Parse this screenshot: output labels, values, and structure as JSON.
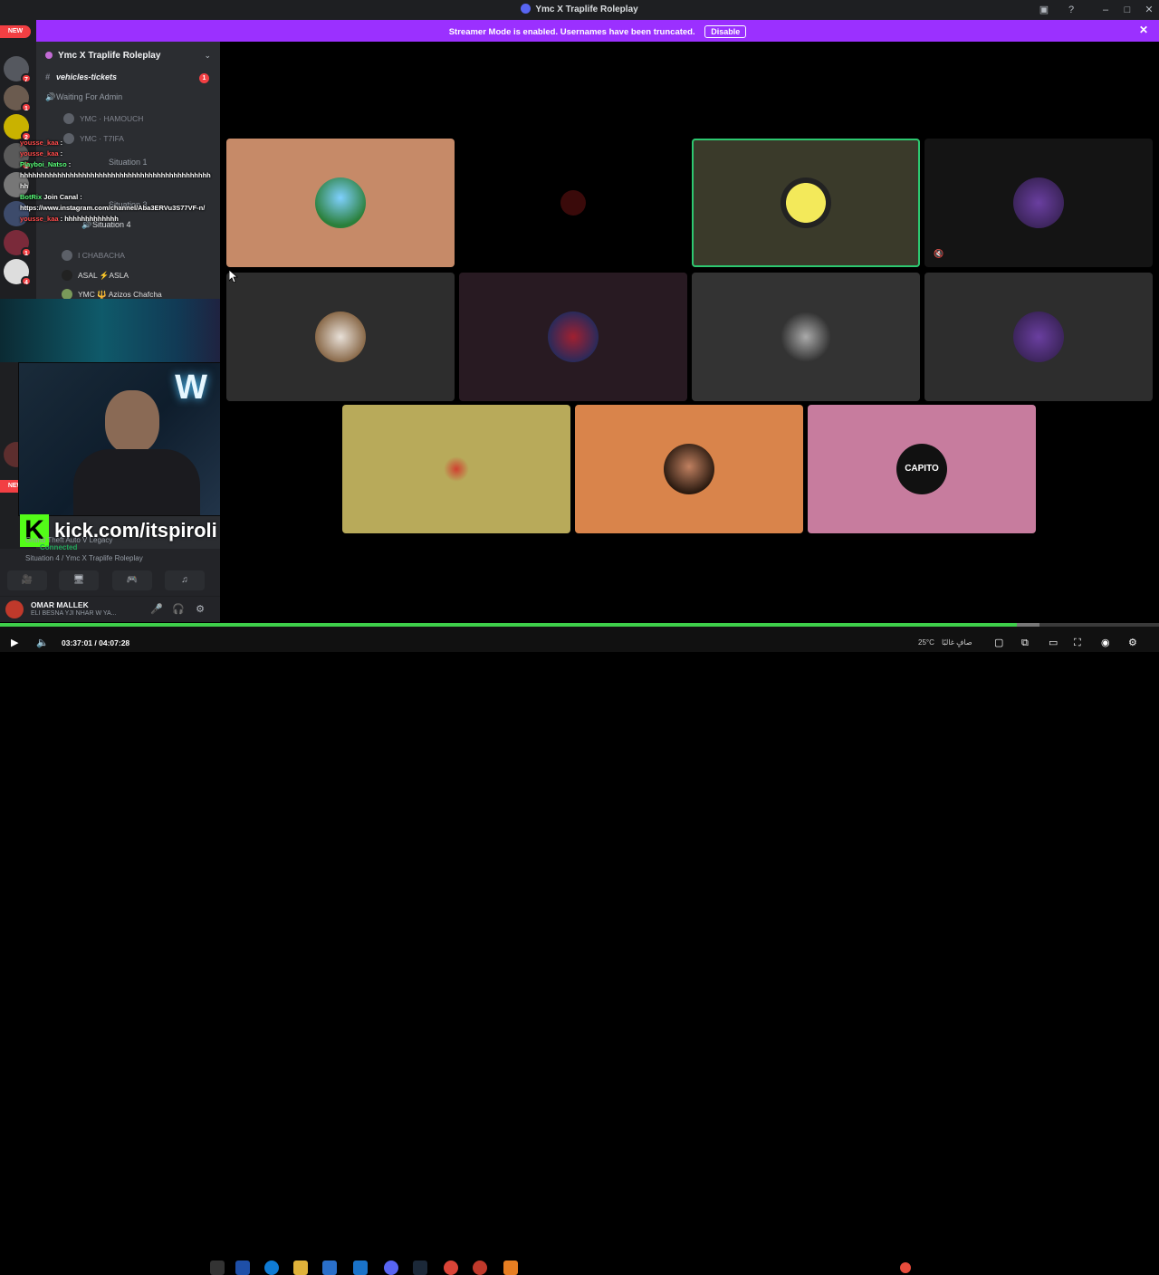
{
  "window": {
    "title": "Ymc X Traplife Roleplay"
  },
  "banner": {
    "message": "Streamer Mode is enabled. Usernames have been truncated.",
    "disable_label": "Disable"
  },
  "guilds": {
    "new_label": "NEW",
    "new_label_bottom": "NEW",
    "badges": [
      "7",
      "1",
      "2",
      "1",
      "1",
      "4",
      "6"
    ]
  },
  "server": {
    "name": "Ymc X Traplife Roleplay",
    "channels": [
      {
        "label": "vehicles-tickets",
        "count": "1"
      },
      {
        "label": "Waiting For Admin"
      }
    ],
    "voice_users": [
      "YMC · HAMOUCH",
      "YMC · T7IFA"
    ],
    "situation_channels": [
      "Situation 1",
      "Situation 3",
      "Situation 4"
    ],
    "situation4_users": [
      "I CHABACHA",
      "ASAL ⚡ASLA",
      "YMC 🔱 Azizos Chafcha"
    ]
  },
  "chat_overlay": [
    {
      "user": "yousse_kaa",
      "text": ":"
    },
    {
      "user": "yousse_kaa",
      "text": ":"
    },
    {
      "user": "Playboi_Natso",
      "text": ":"
    },
    {
      "user": "",
      "text": "hhhhhhhhhhhhhhhhhhhhhhhhhhhhhhhhhhhhhhhhhhhhhhhh"
    },
    {
      "user": "BotRix",
      "text": "Join Canal :"
    },
    {
      "user": "",
      "text": "https://www.instagram.com/channel/Aba3ERVu3S77VF-n/"
    },
    {
      "user": "yousse_kaa",
      "text": ": hhhhhhhhhhhhh"
    }
  ],
  "stream": {
    "kick_letter": "K",
    "kick_url": "kick.com/itspiroli"
  },
  "voice_panel": {
    "connected_label": "Connected",
    "location": "Situation 4 / Ymc X Traplife Roleplay",
    "game": "Grand Theft Auto V Legacy"
  },
  "user_panel": {
    "name": "OMAR MALLEK",
    "status": "ELI BESNA YJI NHAR W YA..."
  },
  "tiles": [
    {
      "bg": "#c68a68",
      "speaking": false,
      "avatar": "beach-photo"
    },
    {
      "bg": "#000000",
      "speaking": false,
      "avatar": "small-logo"
    },
    {
      "bg": "#3a3a2a",
      "speaking": true,
      "avatar": "yellow-cartoon"
    },
    {
      "bg": "#141414",
      "speaking": false,
      "avatar": "purple-creature",
      "muted": true
    },
    {
      "bg": "#2d2d2d",
      "speaking": false,
      "avatar": "man-with-dog"
    },
    {
      "bg": "#281a22",
      "speaking": false,
      "avatar": "red-figure"
    },
    {
      "bg": "#333333",
      "speaking": false,
      "avatar": "man-photo"
    },
    {
      "bg": "#2d2d2d",
      "speaking": false,
      "avatar": "purple-creature"
    },
    {
      "bg": "#b8aa5a",
      "speaking": false,
      "avatar": "small-sprite"
    },
    {
      "bg": "#d9844b",
      "speaking": false,
      "avatar": "bearded-man"
    },
    {
      "bg": "#c77c9e",
      "speaking": false,
      "avatar": "capito-logo",
      "label": "CAPITO"
    }
  ],
  "player": {
    "current_time": "03:37:01",
    "duration": "04:07:28",
    "progress": 0.877
  },
  "tray": {
    "temperature": "25°C",
    "weather": "صافٍ غالبًا"
  },
  "colors": {
    "banner": "#9b30ff",
    "discord_dark": "#1e1f22",
    "sidebar": "#2b2d31",
    "speaking_outline": "#2dc770",
    "kick_green": "#53fc18",
    "progress": "#3ecf4a"
  }
}
